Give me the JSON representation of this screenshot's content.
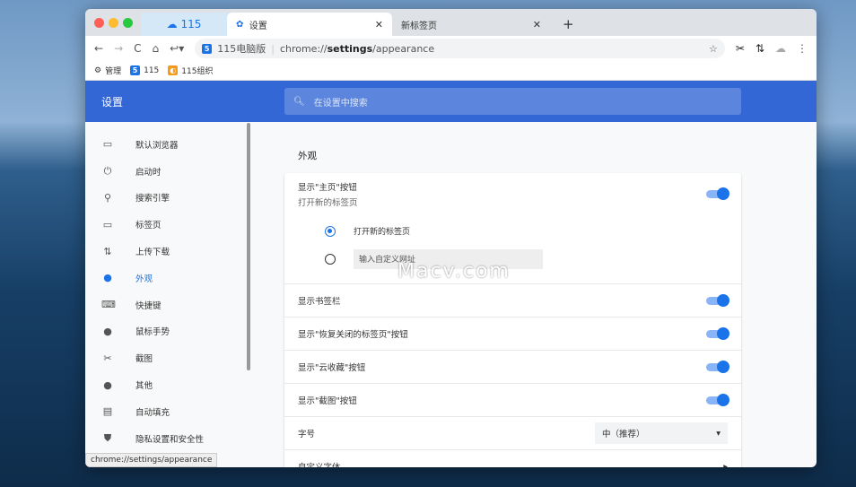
{
  "tabs": [
    {
      "label": "115"
    },
    {
      "label": "设置"
    },
    {
      "label": "新标签页"
    }
  ],
  "toolbar": {
    "site_label": "115电脑版",
    "url_host": "chrome://",
    "url_bold": "settings",
    "url_rest": "/appearance"
  },
  "bookmarks": [
    {
      "label": "管理"
    },
    {
      "label": "115"
    },
    {
      "label": "115组织"
    }
  ],
  "header": {
    "title": "设置",
    "search_placeholder": "在设置中搜索"
  },
  "sidebar": {
    "items": [
      {
        "label": "默认浏览器",
        "icon": "browser-icon"
      },
      {
        "label": "启动时",
        "icon": "power-icon"
      },
      {
        "label": "搜索引擎",
        "icon": "search-icon"
      },
      {
        "label": "标签页",
        "icon": "tab-icon"
      },
      {
        "label": "上传下载",
        "icon": "transfer-icon"
      },
      {
        "label": "外观",
        "icon": "palette-icon"
      },
      {
        "label": "快捷键",
        "icon": "keyboard-icon"
      },
      {
        "label": "鼠标手势",
        "icon": "mouse-icon"
      },
      {
        "label": "截图",
        "icon": "scissors-icon"
      },
      {
        "label": "其他",
        "icon": "person-icon"
      },
      {
        "label": "自动填充",
        "icon": "clipboard-icon"
      },
      {
        "label": "隐私设置和安全性",
        "icon": "shield-icon"
      }
    ]
  },
  "main": {
    "section_title": "外观",
    "home": {
      "title": "显示\"主页\"按钮",
      "subtitle": "打开新的标签页",
      "radio1": "打开新的标签页",
      "radio2": "输入自定义网址"
    },
    "rows": [
      {
        "label": "显示书签栏"
      },
      {
        "label": "显示\"恢复关闭的标签页\"按钮"
      },
      {
        "label": "显示\"云收藏\"按钮"
      },
      {
        "label": "显示\"截图\"按钮"
      }
    ],
    "font_size": {
      "label": "字号",
      "value": "中（推荐）"
    },
    "custom_font": {
      "label": "自定义字体"
    }
  },
  "status_url": "chrome://settings/appearance",
  "watermark": "Macv.com",
  "colors": {
    "accent": "#1a73e8",
    "header": "#3367d6"
  }
}
